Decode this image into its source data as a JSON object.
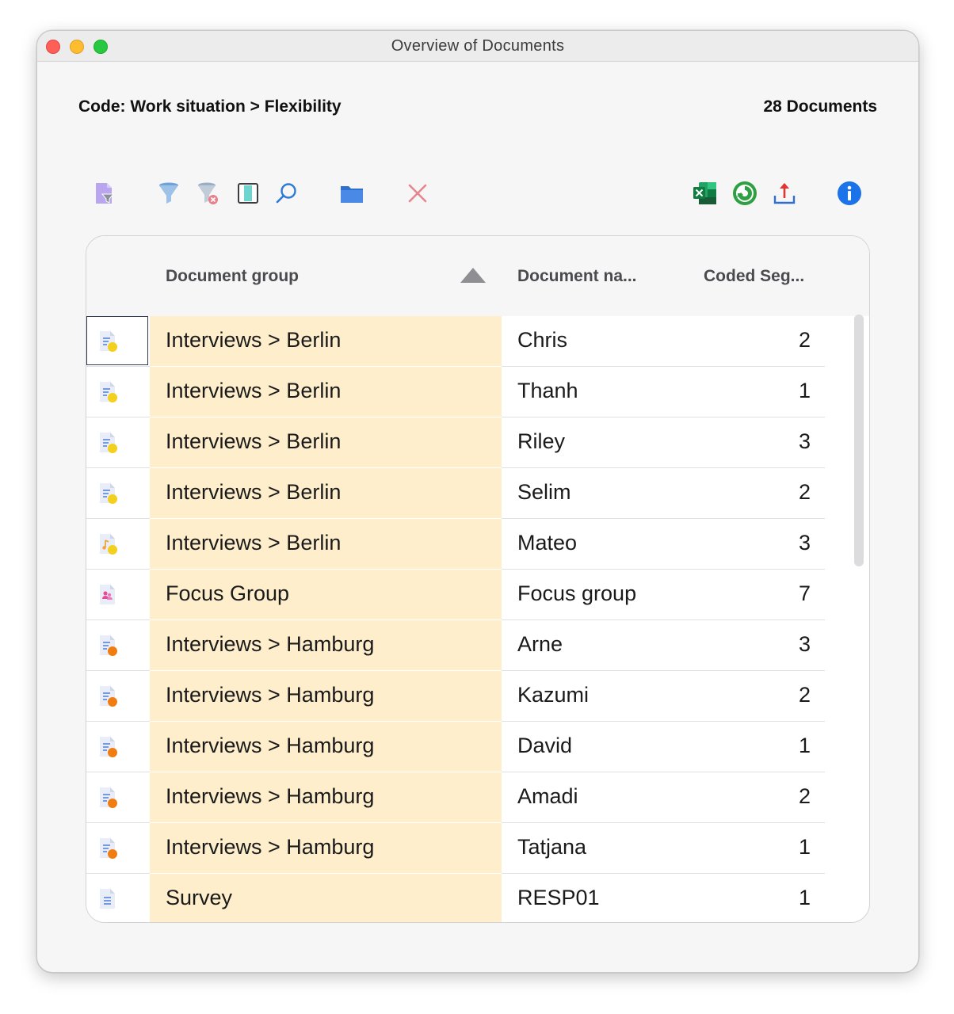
{
  "window": {
    "title": "Overview of Documents"
  },
  "header": {
    "code_label": "Code: Work situation > Flexibility",
    "doc_count": "28 Documents"
  },
  "toolbar": {
    "icons": [
      "activate-documents-icon",
      "filter-icon",
      "clear-filter-icon",
      "columns-icon",
      "search-icon",
      "folder-icon",
      "delete-icon",
      "excel-export-icon",
      "smartpublisher-icon",
      "export-icon",
      "info-icon"
    ]
  },
  "table": {
    "columns": [
      "Document group",
      "Document na...",
      "Coded Seg..."
    ],
    "sort": "ascending",
    "rows": [
      {
        "icon": "text-document-yellow",
        "group": "Interviews > Berlin",
        "name": "Chris",
        "segments": "2"
      },
      {
        "icon": "text-document-yellow",
        "group": "Interviews > Berlin",
        "name": "Thanh",
        "segments": "1"
      },
      {
        "icon": "text-document-yellow",
        "group": "Interviews > Berlin",
        "name": "Riley",
        "segments": "3"
      },
      {
        "icon": "text-document-yellow",
        "group": "Interviews > Berlin",
        "name": "Selim",
        "segments": "2"
      },
      {
        "icon": "audio-document-yellow",
        "group": "Interviews > Berlin",
        "name": "Mateo",
        "segments": "3"
      },
      {
        "icon": "focus-group-document",
        "group": "Focus Group",
        "name": "Focus group",
        "segments": "7"
      },
      {
        "icon": "text-document-orange",
        "group": "Interviews > Hamburg",
        "name": "Arne",
        "segments": "3"
      },
      {
        "icon": "text-document-orange",
        "group": "Interviews > Hamburg",
        "name": "Kazumi",
        "segments": "2"
      },
      {
        "icon": "text-document-orange",
        "group": "Interviews > Hamburg",
        "name": "David",
        "segments": "1"
      },
      {
        "icon": "text-document-orange",
        "group": "Interviews > Hamburg",
        "name": "Amadi",
        "segments": "2"
      },
      {
        "icon": "text-document-orange",
        "group": "Interviews > Hamburg",
        "name": "Tatjana",
        "segments": "1"
      },
      {
        "icon": "table-document",
        "group": "Survey",
        "name": "RESP01",
        "segments": "1"
      }
    ]
  },
  "colors": {
    "group_column_bg": "#feeecb",
    "yellow_dot": "#f2d01c",
    "orange_dot": "#f07d12",
    "accent_blue": "#1a73e8"
  }
}
